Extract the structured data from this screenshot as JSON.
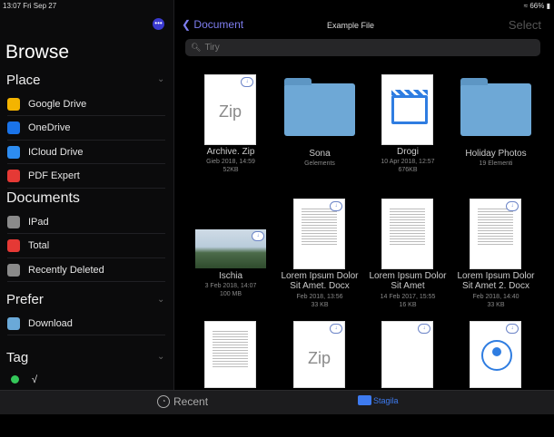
{
  "status": {
    "time_date": "13:07 Fri Sep 27",
    "battery": "66%"
  },
  "sidebar": {
    "title": "Browse",
    "sections": {
      "place": "Place",
      "documents": "Documents",
      "prefer": "Prefer",
      "tag": "Tag"
    },
    "places": [
      {
        "label": "Google Drive",
        "icon": "google-drive-icon",
        "color": "#f4b400"
      },
      {
        "label": "OneDrive",
        "icon": "onedrive-icon",
        "color": "#1a73e8"
      },
      {
        "label": "ICloud Drive",
        "icon": "icloud-icon",
        "color": "#2d8cf0"
      },
      {
        "label": "PDF Expert",
        "icon": "pdf-expert-icon",
        "color": "#e53935"
      }
    ],
    "documents": [
      {
        "label": "IPad",
        "icon": "ipad-icon",
        "color": "#8a8a8a"
      },
      {
        "label": "Total",
        "icon": "total-icon",
        "color": "#e53935"
      },
      {
        "label": "Recently Deleted",
        "icon": "trash-icon",
        "color": "#8a8a8a"
      }
    ],
    "favorites": [
      {
        "label": "Download",
        "icon": "folder-icon",
        "color": "#6aa9d8"
      }
    ],
    "tags": [
      {
        "label": "√",
        "color": "#34c759"
      }
    ]
  },
  "nav": {
    "back_label": "Document",
    "title": "Example File",
    "select_label": "Select",
    "search_placeholder": "Tiry"
  },
  "files": [
    {
      "name": "Archive. Zip",
      "meta1": "Gieb 2018, 14:59",
      "meta2": "52KB",
      "kind": "zip",
      "cloud": true
    },
    {
      "name": "Sona",
      "meta1": "Gelements",
      "meta2": "",
      "kind": "folder",
      "cloud": false
    },
    {
      "name": "Drogi",
      "meta1": "10 Apr 2018, 12:57",
      "meta2": "676KB",
      "kind": "video",
      "cloud": false
    },
    {
      "name": "Holiday Photos",
      "meta1": "19 Elementi",
      "meta2": "",
      "kind": "folder",
      "cloud": false
    },
    {
      "name": "Ischia",
      "meta1": "3 Feb 2018, 14:07",
      "meta2": "100 MB",
      "kind": "photo",
      "cloud": true
    },
    {
      "name": "Lorem Ipsum Dolor Sit Amet. Docx",
      "meta1": "Feb 2018, 13:56",
      "meta2": "33 KB",
      "kind": "doc",
      "cloud": true
    },
    {
      "name": "Lorem Ipsum Dolor Sit Amet",
      "meta1": "14 Feb 2017, 15:55",
      "meta2": "16 KB",
      "kind": "doc",
      "cloud": false
    },
    {
      "name": "Lorem Ipsum Dolor Sit Amet 2. Docx",
      "meta1": "Feb 2018, 14:40",
      "meta2": "33 KB",
      "kind": "doc",
      "cloud": true
    },
    {
      "name": "",
      "meta1": "",
      "meta2": "",
      "kind": "doc",
      "cloud": false
    },
    {
      "name": "",
      "meta1": "",
      "meta2": "",
      "kind": "zip",
      "cloud": true
    },
    {
      "name": "",
      "meta1": "",
      "meta2": "",
      "kind": "blank",
      "cloud": true
    },
    {
      "name": "",
      "meta1": "",
      "meta2": "",
      "kind": "contact",
      "cloud": true
    }
  ],
  "tabbar": {
    "recent_label": "Recent",
    "browse_label": "Stagila",
    "accent": "#3e7bf0"
  }
}
